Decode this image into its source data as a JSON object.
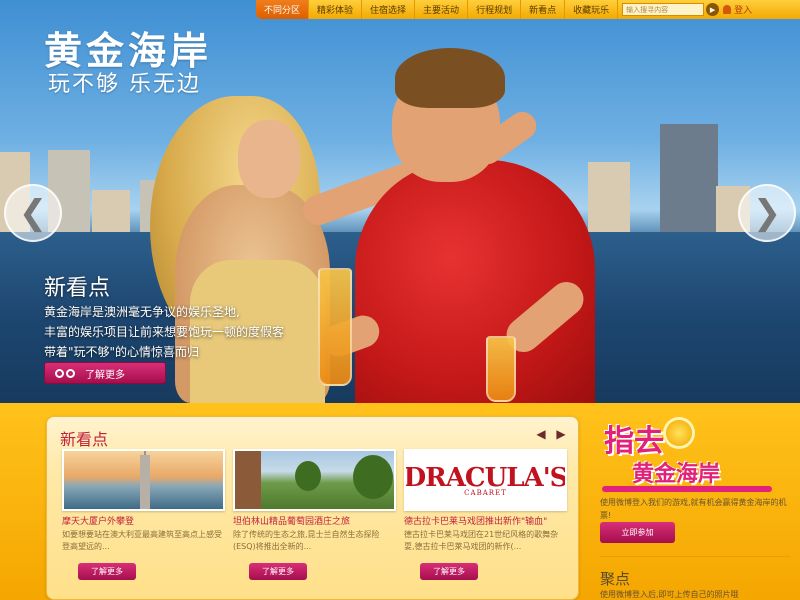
{
  "brand": {
    "logo_title": "黄金海岸",
    "logo_slogan": "玩不够 乐无边"
  },
  "topnav": {
    "items": [
      "不同分区",
      "精彩体验",
      "住宿选择",
      "主要活动",
      "行程规划",
      "新看点",
      "收藏玩乐"
    ],
    "active_index": 0,
    "search_placeholder": "输入搜寻内容",
    "login_label": "登入"
  },
  "hero": {
    "title": "新看点",
    "lines": [
      "黄金海岸是澳洲毫无争议的娱乐圣地,",
      "丰富的娱乐项目让前来想要饱玩一顿的度假客",
      "带着\"玩不够\"的心情惊喜而归"
    ],
    "button_label": "了解更多"
  },
  "panel": {
    "title": "新看点",
    "cards": [
      {
        "title": "摩天大厦户外攀登",
        "desc": "如要想要站在澳大利亚最高建筑至高点上感受登高望远的...",
        "button": "了解更多"
      },
      {
        "title": "坦伯林山精品葡萄园酒庄之旅",
        "desc": "除了传统的生态之旅,昆士兰自然生态探险(ESQ)将推出全新的...",
        "button": "了解更多"
      },
      {
        "title": "德古拉卡巴莱马戏团推出新作\"输血\"",
        "desc": "德古拉卡巴莱马戏团在21世纪风格的歌舞杂耍,德古拉卡巴莱马戏团的新作(...",
        "button": "了解更多",
        "logo_text": "DRACULA'S",
        "logo_sub": "CABARET"
      }
    ]
  },
  "sidebar": {
    "promo_line1": "指去",
    "promo_line2": "黄金海岸",
    "text": "使用微博登入我们的游戏,就有机会赢得黄金海岸的机票!",
    "button": "立即参加",
    "title2": "聚点",
    "text2": "使用微博登入后,即可上传自己的照片哦"
  },
  "colors": {
    "accent_pink": "#c0213d",
    "button_magenta": "#b3145a",
    "brand_yellow": "#f6b400",
    "nav_active": "#e96a0c"
  },
  "icons": {
    "hero_prev": "chevron-left-icon",
    "hero_next": "chevron-right-icon",
    "binoculars": "binoculars-icon",
    "search": "search-icon",
    "login": "user-icon"
  }
}
